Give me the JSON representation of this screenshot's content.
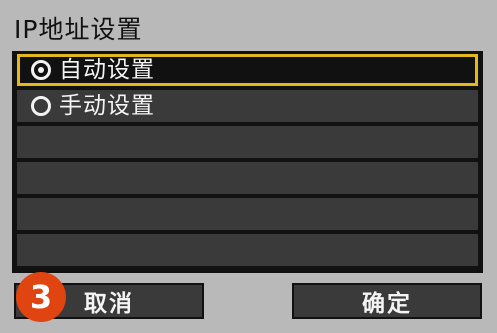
{
  "screen": {
    "title": "IP地址设置"
  },
  "options": [
    {
      "label": "自动设置",
      "selected": true
    },
    {
      "label": "手动设置",
      "selected": false
    }
  ],
  "buttons": {
    "cancel_label": "取消",
    "ok_label": "确定"
  },
  "annotation": {
    "step_number": "3",
    "badge_color": "#e04410"
  },
  "colors": {
    "selection_border": "#e5b81a",
    "panel_background": "#111111",
    "row_background": "#3a3a3a",
    "screen_background": "#b9b9b9"
  }
}
